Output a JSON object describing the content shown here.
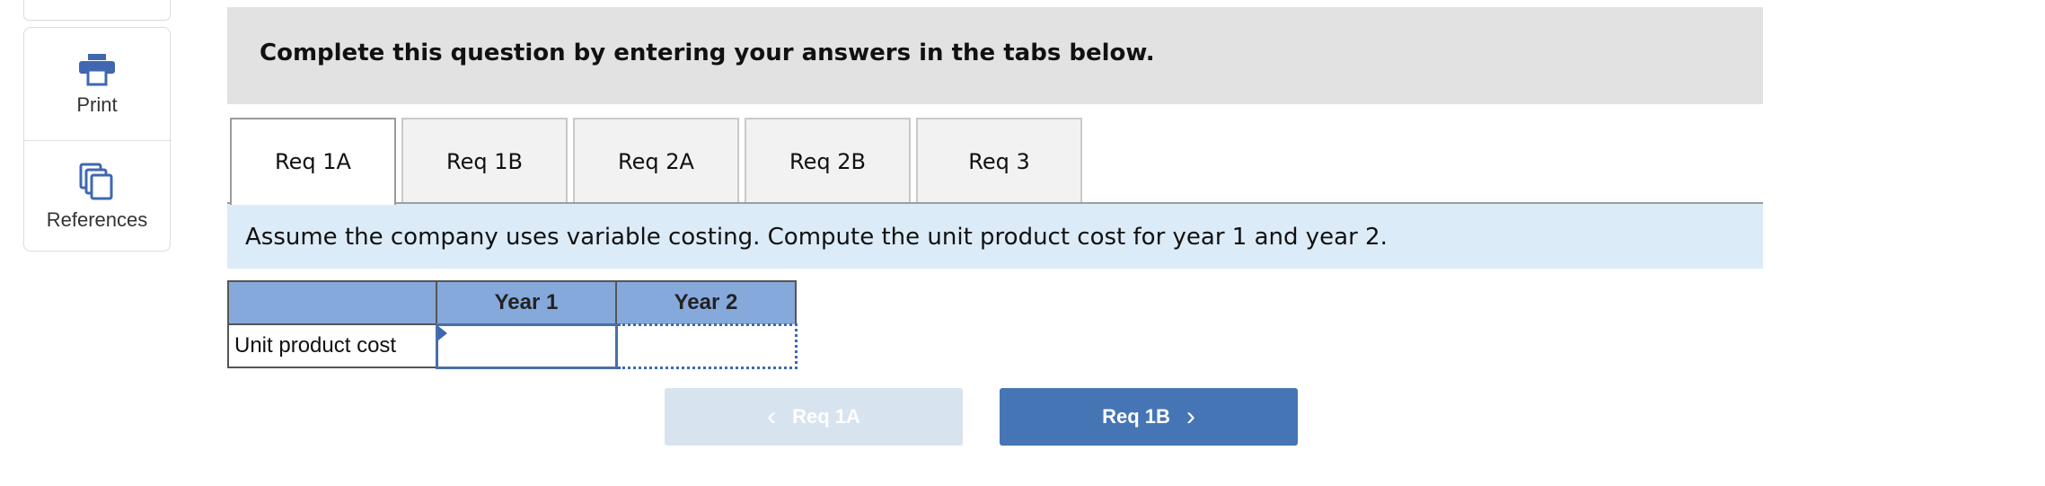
{
  "tools": {
    "print_label": "Print",
    "references_label": "References"
  },
  "banner": {
    "text": "Complete this question by entering your answers in the tabs below."
  },
  "tabs": [
    {
      "label": "Req 1A",
      "active": true
    },
    {
      "label": "Req 1B",
      "active": false
    },
    {
      "label": "Req 2A",
      "active": false
    },
    {
      "label": "Req 2B",
      "active": false
    },
    {
      "label": "Req 3",
      "active": false
    }
  ],
  "prompt": {
    "text": "Assume the company uses variable costing. Compute the unit product cost for year 1 and year 2."
  },
  "table": {
    "headers": [
      "",
      "Year 1",
      "Year 2"
    ],
    "rows": [
      {
        "label": "Unit product cost",
        "year1": "",
        "year2": ""
      }
    ]
  },
  "nav": {
    "prev_label": "Req 1A",
    "next_label": "Req 1B",
    "prev_chevron": "‹",
    "next_chevron": "›"
  },
  "colors": {
    "accent": "#4575b4",
    "header_fill": "#86a9dc",
    "prompt_bg": "#dcebf8",
    "banner_bg": "#e2e2e2",
    "disabled_button": "#d8e3f0"
  },
  "icons": {
    "print": "printer-icon",
    "references": "documents-icon"
  }
}
